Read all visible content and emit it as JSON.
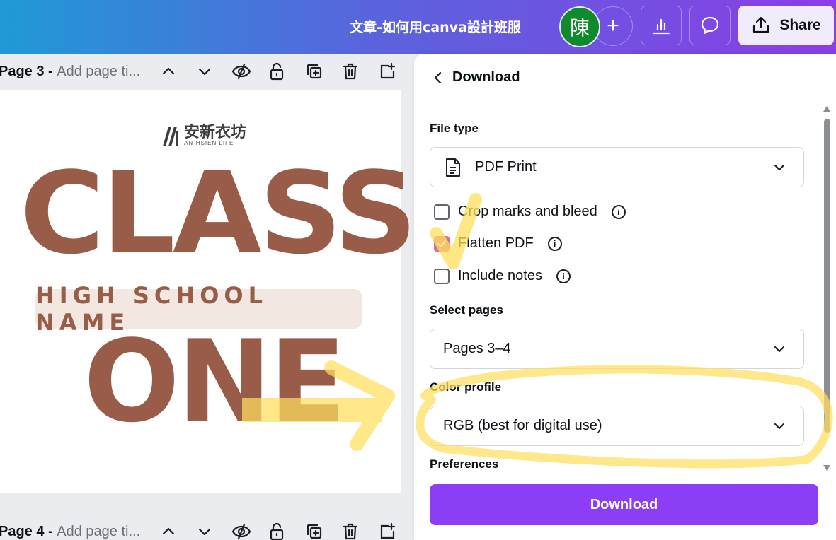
{
  "header": {
    "doc_title": "文章-如何用canva設計班服",
    "avatar_initial": "陳",
    "add_label": "+",
    "share_label": "Share"
  },
  "pages": [
    {
      "prefix": "Page 3 - ",
      "title_placeholder": "Add page ti..."
    },
    {
      "prefix": "Page 4 - ",
      "title_placeholder": "Add page ti..."
    }
  ],
  "canvas": {
    "logo_text": "安新衣坊",
    "logo_sub": "AN-HSIEN LIFE",
    "headline_top": "CLASS",
    "band_text": "HIGH SCHOOL NAME",
    "headline_bottom": "ONE",
    "brown": "#995c48"
  },
  "download_panel": {
    "title": "Download",
    "file_type_label": "File type",
    "file_type_value": "PDF Print",
    "options": [
      {
        "label": "Crop marks and bleed",
        "checked": false
      },
      {
        "label": "Flatten PDF",
        "checked": true
      },
      {
        "label": "Include notes",
        "checked": false
      }
    ],
    "select_pages_label": "Select pages",
    "select_pages_value": "Pages 3–4",
    "color_profile_label": "Color profile",
    "color_profile_value": "RGB (best for digital use)",
    "preferences_label": "Preferences",
    "download_button": "Download",
    "accent": "#8b3ef3"
  },
  "annotations": {
    "highlight_color": "#ffdf5e"
  }
}
